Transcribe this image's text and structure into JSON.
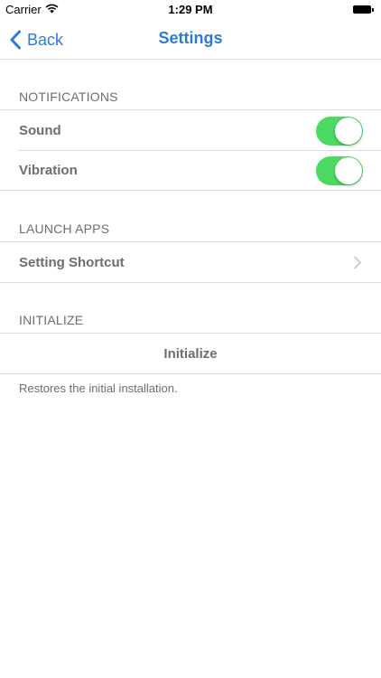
{
  "status_bar": {
    "carrier": "Carrier",
    "time": "1:29 PM"
  },
  "navbar": {
    "back_label": "Back",
    "title": "Settings",
    "accent_color": "#2e7bd7"
  },
  "sections": {
    "notifications": {
      "header": "NOTIFICATIONS",
      "rows": [
        {
          "label": "Sound",
          "toggle_on": true
        },
        {
          "label": "Vibration",
          "toggle_on": true
        }
      ]
    },
    "launch_apps": {
      "header": "LAUNCH APPS",
      "rows": [
        {
          "label": "Setting Shortcut"
        }
      ]
    },
    "initialize": {
      "header": "INITIALIZE",
      "button_label": "Initialize",
      "footer": "Restores the initial installation."
    }
  },
  "colors": {
    "toggle_on": "#4cd964",
    "text_gray": "#6d6d72",
    "separator": "#dcdce0"
  },
  "icons": {
    "wifi": "wifi-icon",
    "battery": "battery-icon",
    "back": "chevron-left-icon",
    "disclosure": "chevron-right-icon"
  }
}
